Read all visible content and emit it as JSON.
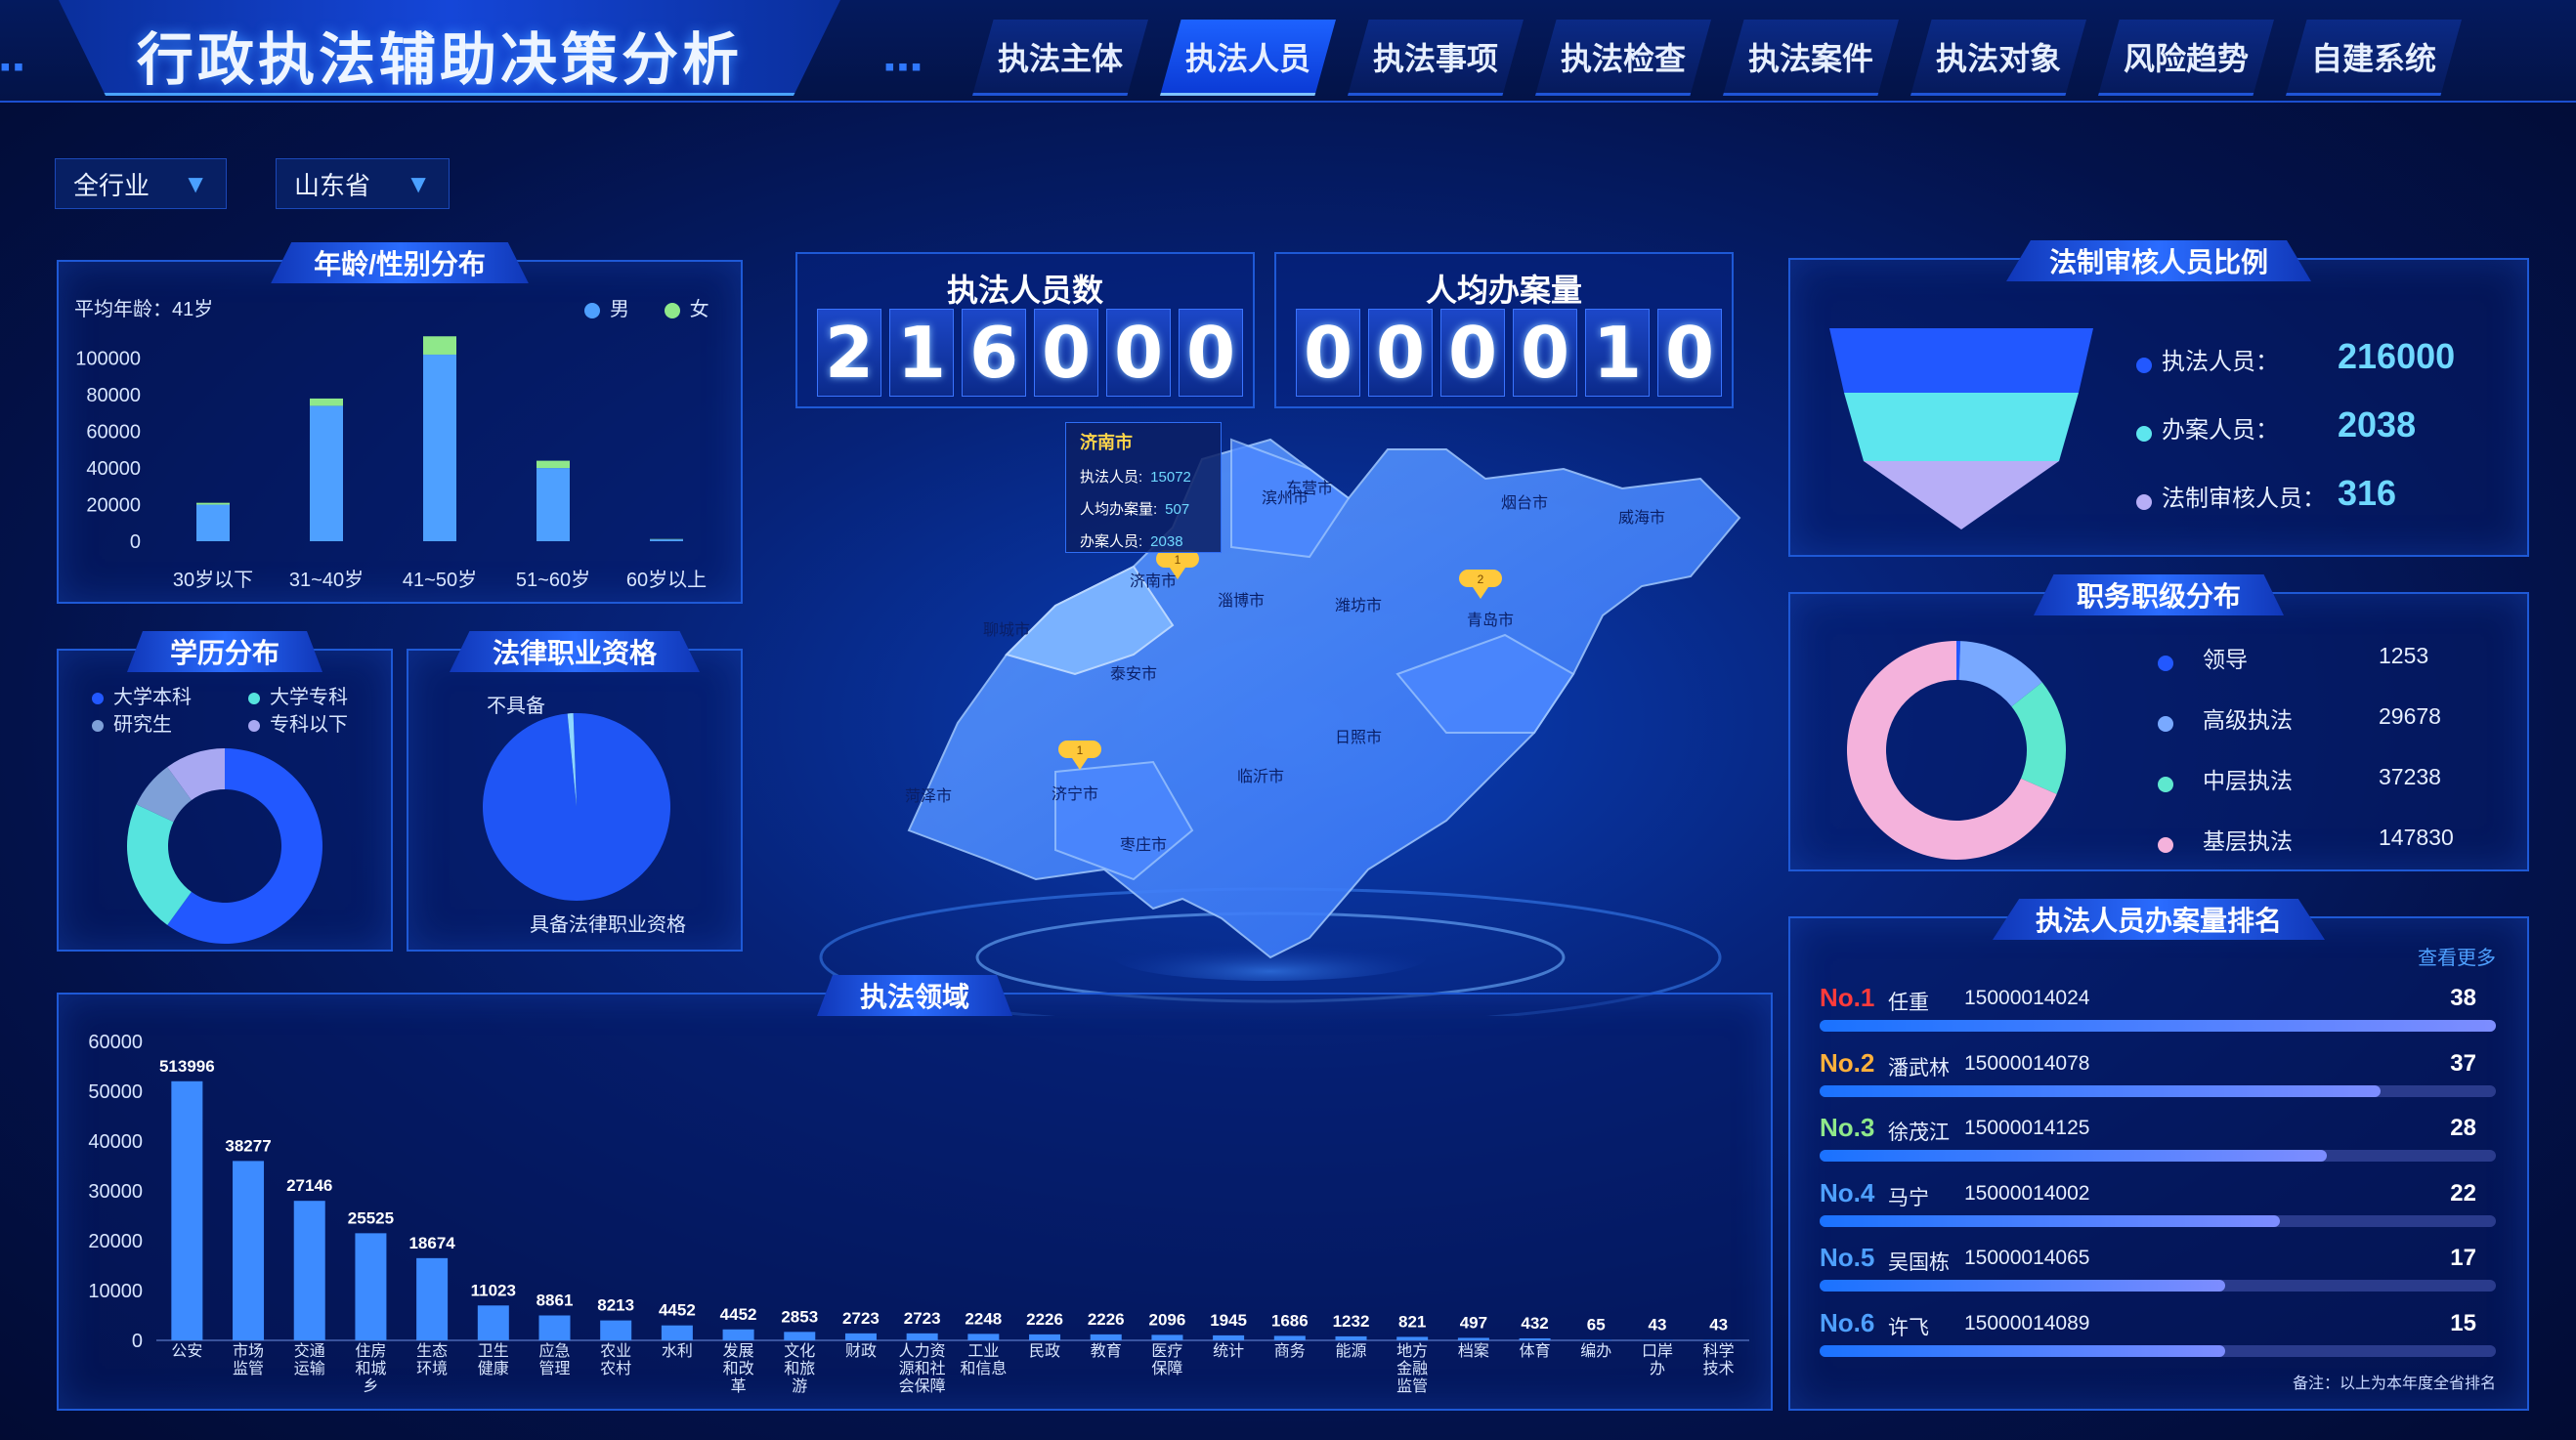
{
  "header": {
    "title": "行政执法辅助决策分析",
    "nav": [
      {
        "label": "执法主体",
        "active": false
      },
      {
        "label": "执法人员",
        "active": true
      },
      {
        "label": "执法事项",
        "active": false
      },
      {
        "label": "执法检查",
        "active": false
      },
      {
        "label": "执法案件",
        "active": false
      },
      {
        "label": "执法对象",
        "active": false
      },
      {
        "label": "风险趋势",
        "active": false
      },
      {
        "label": "自建系统",
        "active": false
      }
    ]
  },
  "filters": {
    "industry": "全行业",
    "province": "山东省"
  },
  "age_panel": {
    "title": "年龄/性别分布",
    "avg_age": "平均年龄：41岁",
    "legend_male": "男",
    "legend_female": "女"
  },
  "education_panel": {
    "title": "学历分布",
    "legend": [
      "大学本科",
      "大学专科",
      "研究生",
      "专科以下"
    ]
  },
  "qualification_panel": {
    "title": "法律职业资格",
    "label_without": "不具备",
    "label_with": "具备法律职业资格"
  },
  "counters": {
    "staff_label": "执法人员数",
    "staff_digits": [
      "2",
      "1",
      "6",
      "0",
      "0",
      "0"
    ],
    "cases_label": "人均办案量",
    "cases_digits": [
      "0",
      "0",
      "0",
      "0",
      "1",
      "0"
    ]
  },
  "map": {
    "tooltip_city": "济南市",
    "tooltip_rows": [
      {
        "label": "执法人员:",
        "value": "15072"
      },
      {
        "label": "人均办案量:",
        "value": "507"
      },
      {
        "label": "办案人员:",
        "value": "2038"
      }
    ],
    "cities": [
      "济南市",
      "聊城市",
      "泰安市",
      "淄博市",
      "潍坊市",
      "东营市",
      "烟台市",
      "威海市",
      "青岛市",
      "日照市",
      "临沂市",
      "济宁市",
      "菏泽市",
      "枣庄市",
      "滨州市"
    ],
    "pins": [
      "1",
      "1",
      "2"
    ]
  },
  "ratio_panel": {
    "title": "法制审核人员比例",
    "rows": [
      {
        "label": "执法人员：",
        "value": "216000",
        "color": "#2258ff"
      },
      {
        "label": "办案人员：",
        "value": "2038",
        "color": "#5de6ee"
      },
      {
        "label": "法制审核人员：",
        "value": "316",
        "color": "#b7aef7"
      }
    ]
  },
  "rank_level_panel": {
    "title": "职务职级分布",
    "rows": [
      {
        "label": "领导",
        "value": "1253",
        "color": "#2258ff"
      },
      {
        "label": "高级执法",
        "value": "29678",
        "color": "#79a9ff"
      },
      {
        "label": "中层执法",
        "value": "37238",
        "color": "#5ee8cf"
      },
      {
        "label": "基层执法",
        "value": "147830",
        "color": "#f4b2dc"
      }
    ]
  },
  "ranking_panel": {
    "title": "执法人员办案量排名",
    "more": "查看更多",
    "note": "备注：以上为本年度全省排名",
    "rows": [
      {
        "no": "No.1",
        "name": "任重",
        "id": "15000014024",
        "value": "38",
        "fraction": 1.0,
        "color": "#ff3b3b"
      },
      {
        "no": "No.2",
        "name": "潘武林",
        "id": "15000014078",
        "value": "37",
        "fraction": 0.83,
        "color": "#ffb13b"
      },
      {
        "no": "No.3",
        "name": "徐茂江",
        "id": "15000014125",
        "value": "28",
        "fraction": 0.75,
        "color": "#8fe88a"
      },
      {
        "no": "No.4",
        "name": "马宁",
        "id": "15000014002",
        "value": "22",
        "fraction": 0.68,
        "color": "#4ea0ff"
      },
      {
        "no": "No.5",
        "name": "吴国栋",
        "id": "15000014065",
        "value": "17",
        "fraction": 0.6,
        "color": "#4ea0ff"
      },
      {
        "no": "No.6",
        "name": "许飞",
        "id": "15000014089",
        "value": "15",
        "fraction": 0.6,
        "color": "#4ea0ff"
      }
    ]
  },
  "domain_panel": {
    "title": "执法领域"
  },
  "chart_data": [
    {
      "type": "bar",
      "title": "年龄/性别分布",
      "categories": [
        "30岁以下",
        "31~40岁",
        "41~50岁",
        "51~60岁",
        "60岁以上"
      ],
      "series": [
        {
          "name": "男",
          "values": [
            20000,
            74000,
            102000,
            40000,
            1000
          ]
        },
        {
          "name": "女",
          "values": [
            1000,
            4000,
            10000,
            4000,
            200
          ]
        }
      ],
      "ylim": [
        0,
        110000
      ],
      "yticks": [
        0,
        20000,
        40000,
        60000,
        80000,
        100000
      ],
      "stacked": true
    },
    {
      "type": "pie",
      "title": "学历分布",
      "labels": [
        "大学本科",
        "大学专科",
        "研究生",
        "专科以下"
      ],
      "values": [
        60,
        22,
        8,
        10
      ],
      "colors": [
        "#2258ff",
        "#56e4de",
        "#7ea0d8",
        "#a8a8f2"
      ]
    },
    {
      "type": "pie",
      "title": "法律职业资格",
      "labels": [
        "具备法律职业资格",
        "不具备"
      ],
      "values": [
        99,
        1
      ],
      "colors": [
        "#1f55f5",
        "#8ed7ff"
      ]
    },
    {
      "type": "bar",
      "title": "法制审核人员比例",
      "categories": [
        "执法人员",
        "办案人员",
        "法制审核人员"
      ],
      "values": [
        216000,
        2038,
        316
      ]
    },
    {
      "type": "pie",
      "title": "职务职级分布",
      "labels": [
        "领导",
        "高级执法",
        "中层执法",
        "基层执法"
      ],
      "values": [
        1253,
        29678,
        37238,
        147830
      ],
      "colors": [
        "#2258ff",
        "#79a9ff",
        "#5ee8cf",
        "#f4b2dc"
      ]
    },
    {
      "type": "bar",
      "title": "执法领域",
      "categories": [
        "公安",
        "市场\n监管",
        "交通\n运输",
        "住房\n和城\n乡",
        "生态\n环境",
        "卫生\n健康",
        "应急\n管理",
        "农业\n农村",
        "水利",
        "发展\n和改\n革",
        "文化\n和旅\n游",
        "财政",
        "人力资\n源和社\n会保障",
        "工业\n和信息",
        "民政",
        "教育",
        "医疗\n保障",
        "统计",
        "商务",
        "能源",
        "地方\n金融\n监管",
        "档案",
        "体育",
        "编办",
        "口岸\n办",
        "科学\n技术"
      ],
      "values": [
        513996,
        38277,
        27146,
        25525,
        18674,
        11023,
        8861,
        8213,
        4452,
        4452,
        2853,
        2723,
        2723,
        2248,
        2226,
        2226,
        2096,
        1945,
        1686,
        1232,
        821,
        497,
        432,
        65,
        43,
        43
      ],
      "bar_heights_axis_values": [
        52000,
        36000,
        28000,
        21500,
        16500,
        7000,
        5000,
        4000,
        3000,
        2200,
        1700,
        1400,
        1400,
        1300,
        1200,
        1200,
        1100,
        1000,
        900,
        800,
        700,
        500,
        400,
        100,
        80,
        80
      ],
      "ylim": [
        0,
        60000
      ],
      "yticks": [
        0,
        10000,
        20000,
        30000,
        40000,
        50000,
        60000
      ]
    }
  ]
}
